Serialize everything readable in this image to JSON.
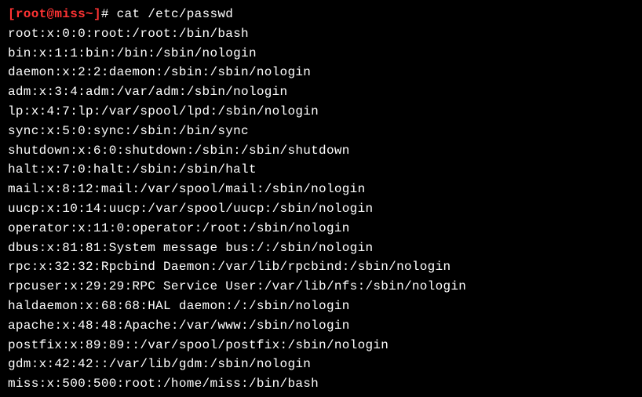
{
  "prompt": {
    "open_bracket": "[",
    "user": "root",
    "at": "@",
    "host": "miss",
    "tilde": "~",
    "close_bracket": "]",
    "hash": "#",
    "command": "cat /etc/passwd"
  },
  "output": [
    "root:x:0:0:root:/root:/bin/bash",
    "bin:x:1:1:bin:/bin:/sbin/nologin",
    "daemon:x:2:2:daemon:/sbin:/sbin/nologin",
    "adm:x:3:4:adm:/var/adm:/sbin/nologin",
    "lp:x:4:7:lp:/var/spool/lpd:/sbin/nologin",
    "sync:x:5:0:sync:/sbin:/bin/sync",
    "shutdown:x:6:0:shutdown:/sbin:/sbin/shutdown",
    "halt:x:7:0:halt:/sbin:/sbin/halt",
    "mail:x:8:12:mail:/var/spool/mail:/sbin/nologin",
    "uucp:x:10:14:uucp:/var/spool/uucp:/sbin/nologin",
    "operator:x:11:0:operator:/root:/sbin/nologin",
    "dbus:x:81:81:System message bus:/:/sbin/nologin",
    "rpc:x:32:32:Rpcbind Daemon:/var/lib/rpcbind:/sbin/nologin",
    "rpcuser:x:29:29:RPC Service User:/var/lib/nfs:/sbin/nologin",
    "haldaemon:x:68:68:HAL daemon:/:/sbin/nologin",
    "apache:x:48:48:Apache:/var/www:/sbin/nologin",
    "postfix:x:89:89::/var/spool/postfix:/sbin/nologin",
    "gdm:x:42:42::/var/lib/gdm:/sbin/nologin",
    "miss:x:500:500:root:/home/miss:/bin/bash"
  ]
}
